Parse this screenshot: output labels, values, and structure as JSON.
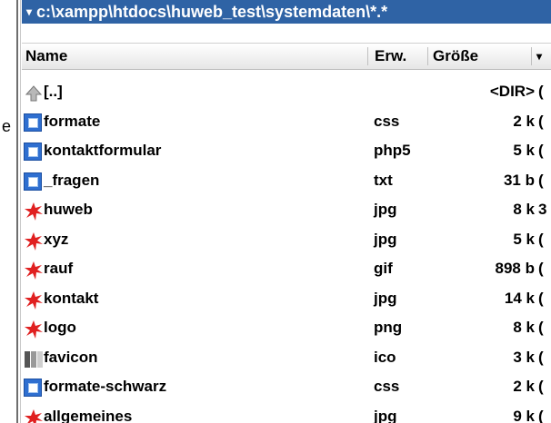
{
  "outside_char": "e",
  "path": {
    "arrow": "▾",
    "text": "c:\\xampp\\htdocs\\huweb_test\\systemdaten\\*.*"
  },
  "header": {
    "name": "Name",
    "ext": "Erw.",
    "size": "Größe",
    "sort_indicator": "▾"
  },
  "rows": [
    {
      "icon": "up-folder-icon",
      "name": "[..]",
      "ext": "",
      "size": "<DIR>",
      "trail": "("
    },
    {
      "icon": "document-icon",
      "name": "formate",
      "ext": "css",
      "size": "2 k",
      "trail": "("
    },
    {
      "icon": "document-icon",
      "name": "kontaktformular",
      "ext": "php5",
      "size": "5 k",
      "trail": "("
    },
    {
      "icon": "document-icon",
      "name": "_fragen",
      "ext": "txt",
      "size": "31 b",
      "trail": "("
    },
    {
      "icon": "image-icon",
      "name": "huweb",
      "ext": "jpg",
      "size": "8 k",
      "trail": "3"
    },
    {
      "icon": "image-icon",
      "name": "xyz",
      "ext": "jpg",
      "size": "5 k",
      "trail": "("
    },
    {
      "icon": "image-icon",
      "name": "rauf",
      "ext": "gif",
      "size": "898 b",
      "trail": "("
    },
    {
      "icon": "image-icon",
      "name": "kontakt",
      "ext": "jpg",
      "size": "14 k",
      "trail": "("
    },
    {
      "icon": "image-icon",
      "name": "logo",
      "ext": "png",
      "size": "8 k",
      "trail": "("
    },
    {
      "icon": "icon-file-icon",
      "name": "favicon",
      "ext": "ico",
      "size": "3 k",
      "trail": "("
    },
    {
      "icon": "document-icon",
      "name": "formate-schwarz",
      "ext": "css",
      "size": "2 k",
      "trail": "("
    },
    {
      "icon": "image-icon",
      "name": "allgemeines",
      "ext": "jpg",
      "size": "9 k",
      "trail": "("
    }
  ],
  "colors": {
    "pathbar": "#2f63a5",
    "document_icon": "#2f6fd0",
    "image_icon": "#e02020"
  }
}
